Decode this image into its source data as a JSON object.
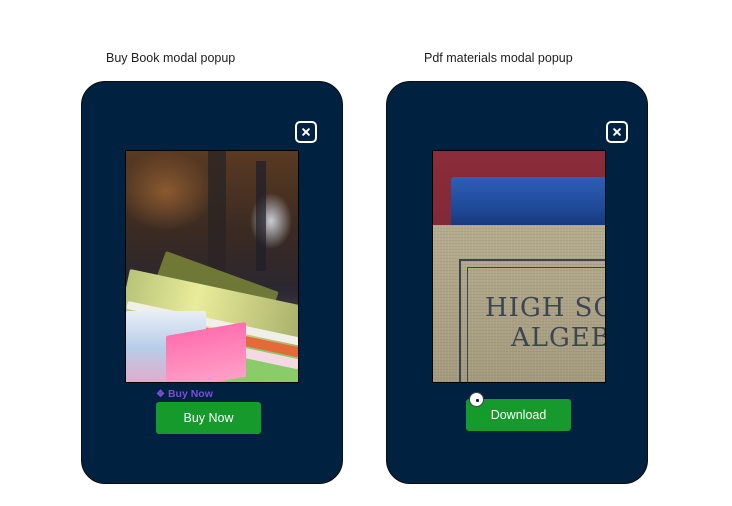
{
  "frames": {
    "left": {
      "label": "Buy Book modal popup",
      "component_tag": "Buy Now",
      "button_label": "Buy Now"
    },
    "right": {
      "label": "Pdf materials modal popup",
      "book_title_line1": "HIGH SCH",
      "book_title_line2": "ALGEB",
      "button_label": "Download"
    }
  },
  "icons": {
    "close": "close-icon",
    "component": "component-diamond-icon",
    "cursor": "cursor-badge-icon"
  },
  "colors": {
    "modal_background": "#002240",
    "primary_button": "#159a2b",
    "component_tag": "#7a4dd8",
    "text": "#1e1e1e"
  }
}
